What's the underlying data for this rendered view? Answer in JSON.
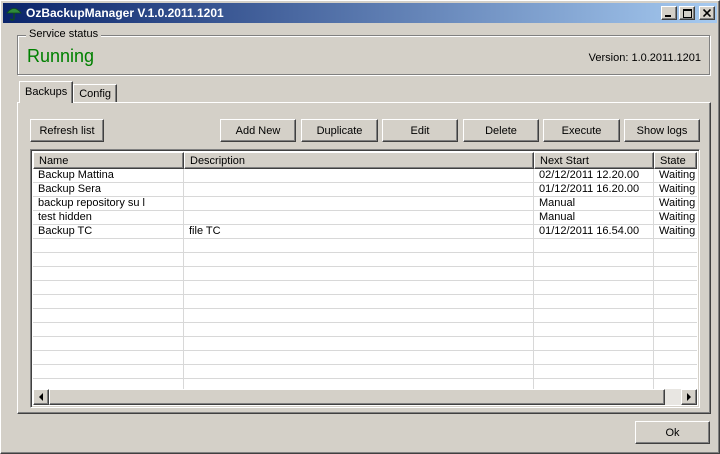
{
  "window": {
    "title": "OzBackupManager V.1.0.2011.1201"
  },
  "service": {
    "group_label": "Service status",
    "status": "Running",
    "status_color": "#008000",
    "version": "Version: 1.0.2011.1201"
  },
  "tabs": [
    {
      "label": "Backups",
      "active": true
    },
    {
      "label": "Config",
      "active": false
    }
  ],
  "toolbar": {
    "refresh": "Refresh list",
    "add_new": "Add New",
    "duplicate": "Duplicate",
    "edit": "Edit",
    "delete": "Delete",
    "execute": "Execute",
    "show_logs": "Show logs"
  },
  "table": {
    "columns": [
      "Name",
      "Description",
      "Next Start",
      "State"
    ],
    "rows": [
      [
        "Backup Mattina",
        "",
        "02/12/2011 12.20.00",
        "Waiting"
      ],
      [
        "Backup Sera",
        "",
        "01/12/2011 16.20.00",
        "Waiting"
      ],
      [
        "backup repository su l",
        "",
        "Manual",
        "Waiting"
      ],
      [
        "test hidden",
        "",
        "Manual",
        "Waiting"
      ],
      [
        "Backup TC",
        "file TC",
        "01/12/2011 16.54.00",
        "Waiting"
      ]
    ]
  },
  "footer": {
    "ok": "Ok"
  }
}
